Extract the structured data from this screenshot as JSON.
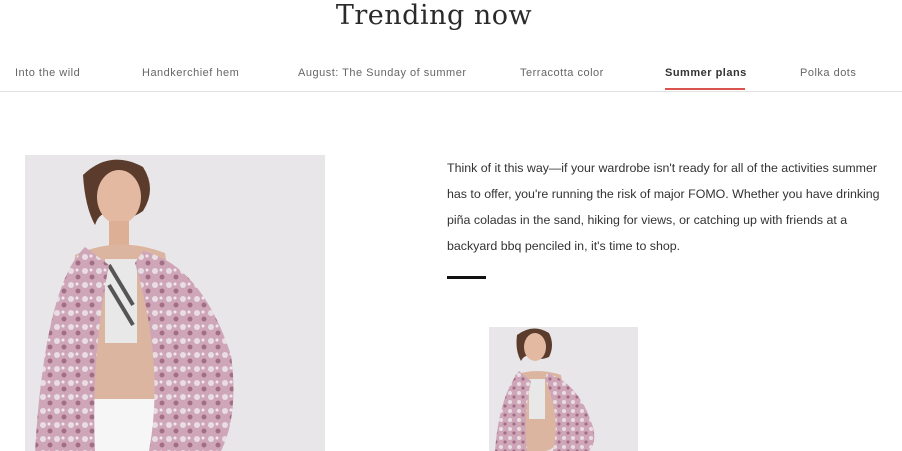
{
  "header": {
    "title": "Trending now"
  },
  "tabs": [
    {
      "label": "Into the wild"
    },
    {
      "label": "Handkerchief hem"
    },
    {
      "label": "August: The Sunday of summer"
    },
    {
      "label": "Terracotta color"
    },
    {
      "label": "Summer plans",
      "active": true
    },
    {
      "label": "Polka dots"
    }
  ],
  "colors": {
    "accent": "#d9534f",
    "text": "#333333",
    "photo_bg": "#e8e6e8"
  },
  "content": {
    "description": "Think of it this way—if your wardrobe isn't ready for all of the activities summer has to offer, you're running the risk of major FOMO. Whether you have drinking piña coladas in the sand, hiking for views, or catching up with friends at a backyard bbq penciled in, it's time to shop."
  }
}
